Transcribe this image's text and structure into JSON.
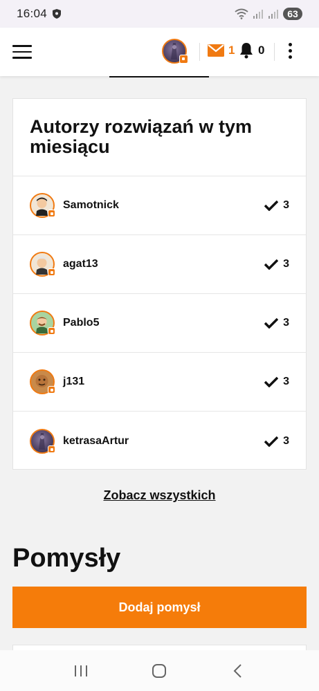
{
  "status_bar": {
    "time": "16:04",
    "battery": "63"
  },
  "header": {
    "mail_count": "1",
    "notification_count": "0"
  },
  "card": {
    "title": "Autorzy rozwiązań w tym miesiącu",
    "authors": [
      {
        "name": "Samotnick",
        "solutions": "3"
      },
      {
        "name": "agat13",
        "solutions": "3"
      },
      {
        "name": "Pablo5",
        "solutions": "3"
      },
      {
        "name": "j131",
        "solutions": "3"
      },
      {
        "name": "ketrasaArtur",
        "solutions": "3"
      }
    ]
  },
  "see_all_label": "Zobacz wszystkich",
  "ideas": {
    "title": "Pomysły",
    "add_button": "Dodaj pomysł"
  },
  "colors": {
    "accent": "#f57c0a",
    "background": "#f2f2f2"
  }
}
